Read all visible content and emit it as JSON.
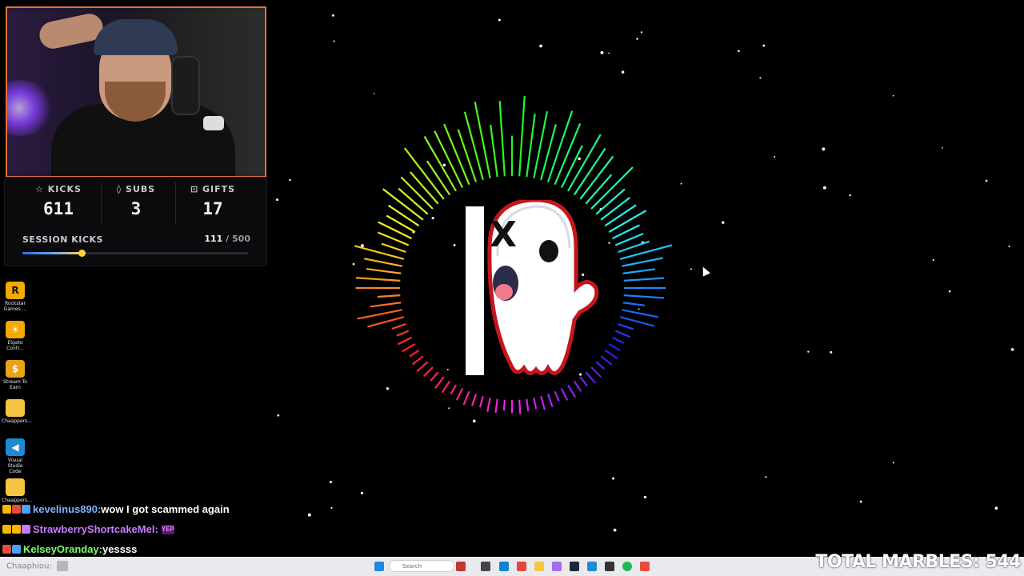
{
  "stats": {
    "kicks_label": "KICKS",
    "kicks_value": "611",
    "subs_label": "SUBS",
    "subs_value": "3",
    "gifts_label": "GIFTS",
    "gifts_value": "17",
    "session_label": "SESSION KICKS",
    "session_current": "111",
    "session_separator": " / ",
    "session_max": "500",
    "session_progress": 0.222
  },
  "desktop_icons": [
    {
      "label": "Rockstar Games ...",
      "glyph": "R",
      "color": "#f2a900",
      "text_color": "#111"
    },
    {
      "label": "Elgato Contr...",
      "glyph": "☀",
      "color": "#f2a900",
      "text_color": "#fff"
    },
    {
      "label": "Stream To Earn",
      "glyph": "$",
      "color": "#e8a317",
      "text_color": "#fff"
    },
    {
      "label": "Chaappers...",
      "glyph": "",
      "color": "#f5c542",
      "text_color": "#fff"
    },
    {
      "label": "Visual Studio Code",
      "glyph": "◀",
      "color": "#1f8ad2",
      "text_color": "#fff"
    },
    {
      "label": "Chaappers...",
      "glyph": "",
      "color": "#f5c542",
      "text_color": "#fff"
    }
  ],
  "chat": [
    {
      "username": "kevelinus890:",
      "message": " wow I got scammed again",
      "color": "#7fb3ff",
      "emote": ""
    },
    {
      "username": "StrawberryShortcakeMel:",
      "message": "",
      "color": "#c77dff",
      "emote": "YEP"
    },
    {
      "username": "KelseyOranday:",
      "message": " yessss",
      "color": "#7dff6a",
      "emote": ""
    }
  ],
  "marbles": "TOTAL MARBLES: 544",
  "taskbar": {
    "left_text": "Chaaphiou:",
    "search_placeholder": "Search"
  }
}
